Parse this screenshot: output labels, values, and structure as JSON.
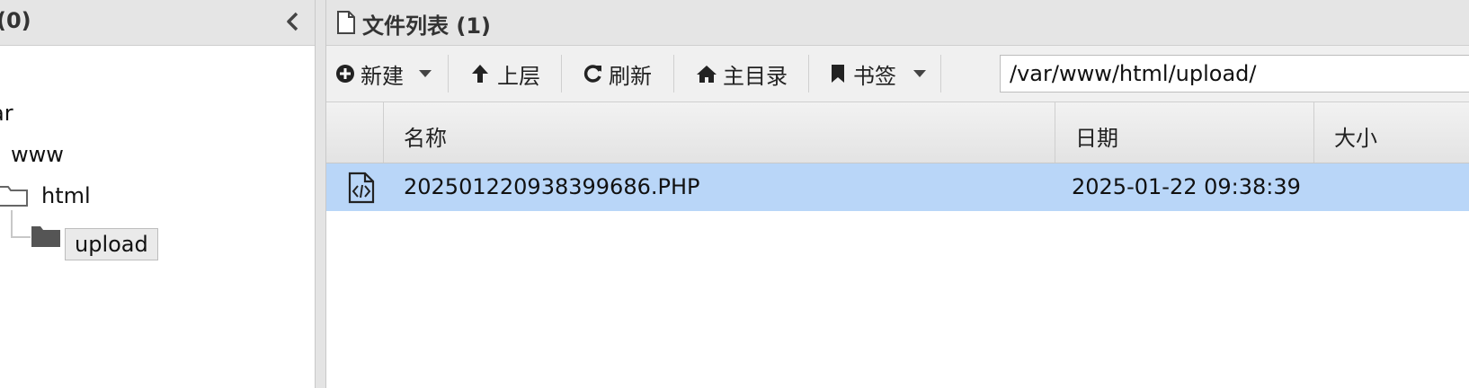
{
  "tree": {
    "title": "(0)",
    "items": [
      {
        "label": "ar"
      },
      {
        "label": "www"
      },
      {
        "label": "html"
      },
      {
        "label": "upload"
      }
    ]
  },
  "file_list": {
    "title": "文件列表 (1)",
    "toolbar": {
      "new_label": "新建",
      "up_label": "上层",
      "refresh_label": "刷新",
      "home_label": "主目录",
      "bookmark_label": "书签"
    },
    "path": "/var/www/html/upload/",
    "columns": [
      "名称",
      "日期",
      "大小"
    ],
    "rows": [
      {
        "name": "202501220938399686.PHP",
        "date": "2025-01-22 09:38:39",
        "size": ""
      }
    ]
  },
  "colors": {
    "selected_row": "#b9d6f8",
    "header_bg": "#e5e5e5",
    "toolbar_bg": "#f0f0f0"
  }
}
